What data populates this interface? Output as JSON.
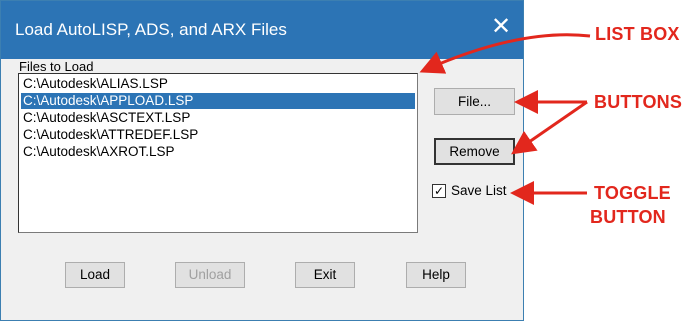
{
  "window": {
    "title": "Load AutoLISP, ADS, and ARX Files",
    "close_glyph": "✕"
  },
  "files": {
    "label": "Files to Load",
    "items": [
      {
        "label": "C:\\Autodesk\\ALIAS.LSP",
        "selected": false
      },
      {
        "label": "C:\\Autodesk\\APPLOAD.LSP",
        "selected": true
      },
      {
        "label": "C:\\Autodesk\\ASCTEXT.LSP",
        "selected": false
      },
      {
        "label": "C:\\Autodesk\\ATTREDEF.LSP",
        "selected": false
      },
      {
        "label": "C:\\Autodesk\\AXROT.LSP",
        "selected": false
      }
    ]
  },
  "side_buttons": {
    "file": "File...",
    "remove": "Remove"
  },
  "save_list": {
    "label": "Save List",
    "checked": true,
    "check_glyph": "✓"
  },
  "bottom_buttons": {
    "load": "Load",
    "unload": "Unload",
    "exit": "Exit",
    "help": "Help"
  },
  "annotations": {
    "list_box": "LIST BOX",
    "buttons": "BUTTONS",
    "toggle_line1": "TOGGLE",
    "toggle_line2": "BUTTON"
  },
  "colors": {
    "accent": "#2c74b5",
    "annotation": "#e2271d"
  }
}
